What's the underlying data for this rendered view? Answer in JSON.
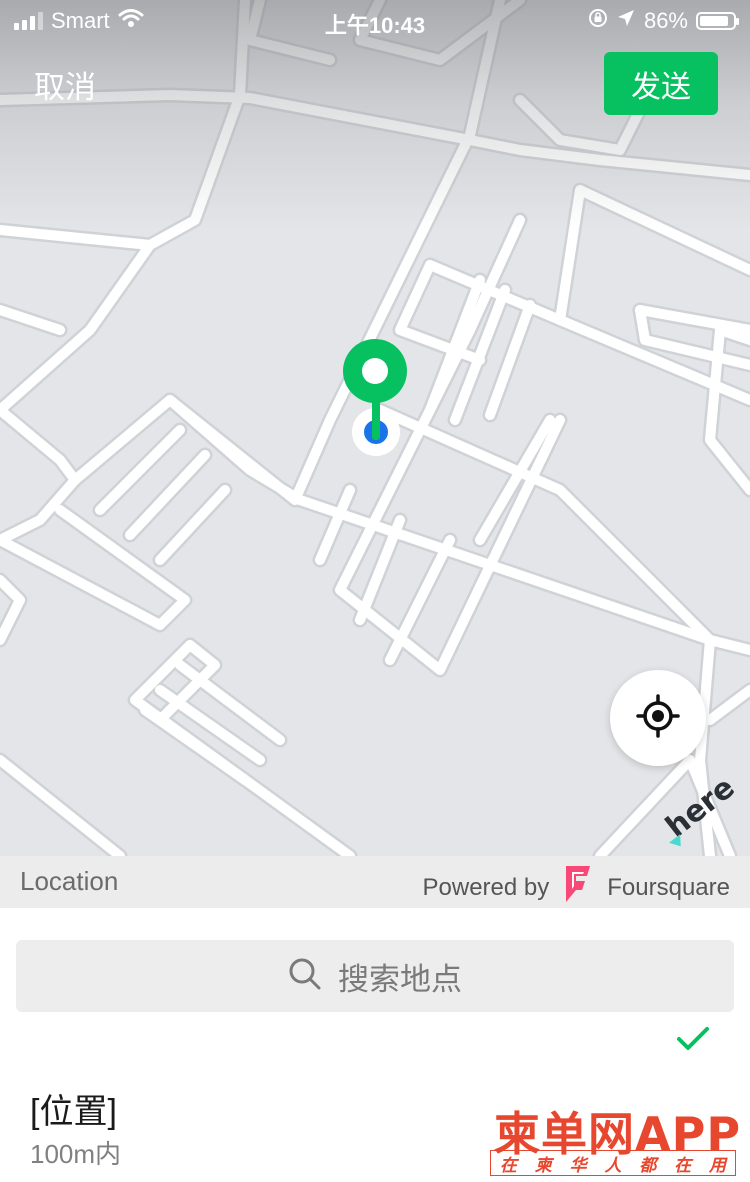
{
  "status_bar": {
    "carrier": "Smart",
    "time": "上午10:43",
    "battery_percent": "86%",
    "battery_level": 0.86,
    "wifi_icon": "wifi-icon",
    "signal_icon": "cell-signal-icon",
    "rotation_lock_icon": "rotation-lock-icon",
    "location_icon": "location-arrow-icon"
  },
  "nav": {
    "cancel_label": "取消",
    "send_label": "发送"
  },
  "map": {
    "pin_icon": "map-pin-icon",
    "current_location_icon": "current-location-dot-icon",
    "locate_icon": "locate-me-icon",
    "provider_logo": "here",
    "colors": {
      "background": "#e3e5e8",
      "road": "#ffffff",
      "pin": "#07c160",
      "dot": "#1a73e8"
    }
  },
  "attribution": {
    "section_label": "Location",
    "powered_by": "Powered by",
    "provider": "Foursquare",
    "provider_icon": "foursquare-icon",
    "provider_color": "#f94877"
  },
  "search": {
    "placeholder": "搜索地点",
    "icon": "search-icon"
  },
  "results": [
    {
      "title": "[位置]",
      "subtitle": "100m内",
      "selected": true,
      "check_icon": "checkmark-icon"
    }
  ],
  "watermark": {
    "main": "柬单网APP",
    "sub": [
      "在",
      "柬",
      "华",
      "人",
      "都",
      "在",
      "用"
    ],
    "color": "#e8472f"
  },
  "accent_color": "#07c160"
}
